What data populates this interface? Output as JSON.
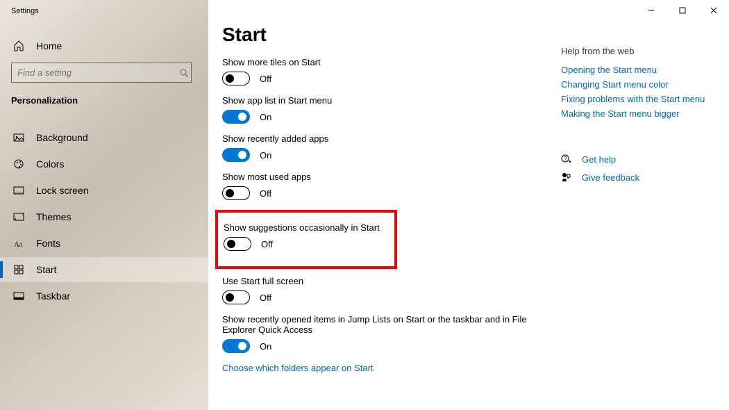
{
  "app": {
    "title": "Settings"
  },
  "window": {
    "minimize": "–",
    "maximize": "□",
    "close": "×"
  },
  "sidebar": {
    "home": "Home",
    "search_placeholder": "Find a setting",
    "section": "Personalization",
    "items": [
      {
        "label": "Background",
        "icon": "image-icon",
        "active": false
      },
      {
        "label": "Colors",
        "icon": "palette-icon",
        "active": false
      },
      {
        "label": "Lock screen",
        "icon": "lock-screen-icon",
        "active": false
      },
      {
        "label": "Themes",
        "icon": "themes-icon",
        "active": false
      },
      {
        "label": "Fonts",
        "icon": "fonts-icon",
        "active": false
      },
      {
        "label": "Start",
        "icon": "start-icon",
        "active": true
      },
      {
        "label": "Taskbar",
        "icon": "taskbar-icon",
        "active": false
      }
    ]
  },
  "page": {
    "title": "Start",
    "settings": [
      {
        "label": "Show more tiles on Start",
        "state": "Off",
        "on": false
      },
      {
        "label": "Show app list in Start menu",
        "state": "On",
        "on": true
      },
      {
        "label": "Show recently added apps",
        "state": "On",
        "on": true
      },
      {
        "label": "Show most used apps",
        "state": "Off",
        "on": false
      },
      {
        "label": "Show suggestions occasionally in Start",
        "state": "Off",
        "on": false,
        "highlight": true
      },
      {
        "label": "Use Start full screen",
        "state": "Off",
        "on": false
      },
      {
        "label": "Show recently opened items in Jump Lists on Start or the taskbar and in File Explorer Quick Access",
        "state": "On",
        "on": true
      }
    ],
    "footer_link": "Choose which folders appear on Start"
  },
  "aside": {
    "help_title": "Help from the web",
    "links": [
      "Opening the Start menu",
      "Changing Start menu color",
      "Fixing problems with the Start menu",
      "Making the Start menu bigger"
    ],
    "actions": [
      {
        "label": "Get help",
        "icon": "help-icon"
      },
      {
        "label": "Give feedback",
        "icon": "feedback-icon"
      }
    ]
  }
}
